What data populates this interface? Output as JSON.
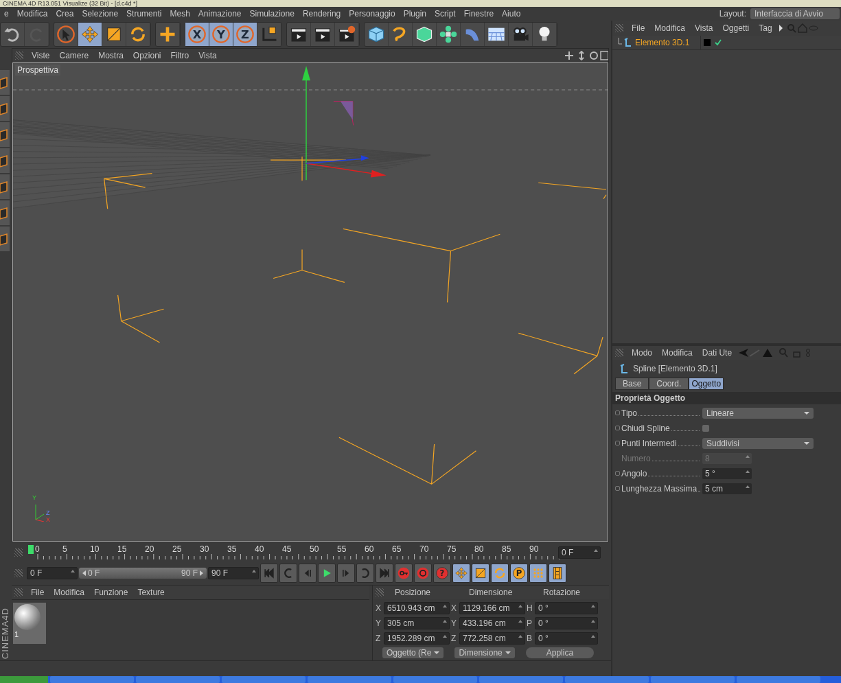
{
  "title_bar": {
    "title": "CINEMA 4D R13.051 Visualize (32 Bit) - [d.c4d *]"
  },
  "menu_bar": {
    "items": [
      "e",
      "Modifica",
      "Crea",
      "Selezione",
      "Strumenti",
      "Mesh",
      "Animazione",
      "Simulazione",
      "Rendering",
      "Personaggio",
      "Plugin",
      "Script",
      "Finestre",
      "Aiuto"
    ],
    "layout_label": "Layout:",
    "layout_value": "Interfaccia di Avvio"
  },
  "toolbar": {
    "groups": [
      [
        {
          "kind": "undo",
          "selected": false,
          "disabled": false
        },
        {
          "kind": "redo",
          "selected": false,
          "disabled": true
        }
      ],
      [
        {
          "kind": "select",
          "selected": false,
          "disabled": false
        },
        {
          "kind": "move",
          "selected": true,
          "disabled": false
        },
        {
          "kind": "scale",
          "selected": false,
          "disabled": false
        },
        {
          "kind": "rotate",
          "selected": false,
          "disabled": false
        }
      ],
      [
        {
          "kind": "add",
          "selected": false,
          "disabled": false
        }
      ],
      [
        {
          "kind": "axis",
          "label": "X",
          "selected": true,
          "disabled": false
        },
        {
          "kind": "axis",
          "label": "Y",
          "selected": true,
          "disabled": false
        },
        {
          "kind": "axis",
          "label": "Z",
          "selected": true,
          "disabled": false
        },
        {
          "kind": "coords",
          "selected": false,
          "disabled": false
        }
      ],
      [
        {
          "kind": "render",
          "selected": false,
          "disabled": false
        },
        {
          "kind": "render",
          "selected": false,
          "disabled": false
        },
        {
          "kind": "render-settings",
          "selected": false,
          "disabled": false
        }
      ],
      [
        {
          "kind": "cube",
          "selected": false,
          "disabled": false
        },
        {
          "kind": "spline",
          "selected": false,
          "disabled": false
        },
        {
          "kind": "subdivision",
          "selected": false,
          "disabled": false
        },
        {
          "kind": "cloner",
          "selected": false,
          "disabled": false
        },
        {
          "kind": "deformer",
          "selected": false,
          "disabled": false
        },
        {
          "kind": "floor",
          "selected": false,
          "disabled": false
        },
        {
          "kind": "camera",
          "selected": false,
          "disabled": false
        },
        {
          "kind": "light",
          "selected": false,
          "disabled": false
        }
      ]
    ]
  },
  "viewport": {
    "menu": [
      "Viste",
      "Camere",
      "Mostra",
      "Opzioni",
      "Filtro",
      "Vista"
    ],
    "view_name": "Prospettiva",
    "axis_labels": [
      "Y",
      "Z",
      "X"
    ]
  },
  "object_manager": {
    "menu": [
      "File",
      "Modifica",
      "Vista",
      "Oggetti",
      "Tag"
    ],
    "objects": [
      {
        "name": "Elemento 3D.1",
        "selected": true,
        "enabled": true
      }
    ]
  },
  "attribute_manager": {
    "menu": [
      "Modo",
      "Modifica",
      "Dati Ute"
    ],
    "title": "Spline [Elemento 3D.1]",
    "tabs": [
      {
        "label": "Base",
        "selected": false
      },
      {
        "label": "Coord.",
        "selected": false
      },
      {
        "label": "Oggetto",
        "selected": true
      }
    ],
    "section": "Proprietà Oggetto",
    "fields": [
      {
        "kind": "dropdown",
        "label": "Tipo",
        "value": "Lineare",
        "disabled": false
      },
      {
        "kind": "checkbox",
        "label": "Chiudi Spline",
        "checked": false,
        "disabled": false
      },
      {
        "kind": "dropdown",
        "label": "Punti Intermedi",
        "value": "Suddivisi",
        "disabled": false
      },
      {
        "kind": "number",
        "label": "Numero",
        "value": "8",
        "disabled": true
      },
      {
        "kind": "number",
        "label": "Angolo",
        "value": "5 °",
        "disabled": false
      },
      {
        "kind": "number",
        "label": "Lunghezza Massima",
        "value": "5 cm",
        "disabled": false
      }
    ]
  },
  "timeline": {
    "labels": [
      "0",
      "5",
      "10",
      "15",
      "20",
      "25",
      "30",
      "35",
      "40",
      "45",
      "50",
      "55",
      "60",
      "65",
      "70",
      "75",
      "80",
      "85",
      "90"
    ],
    "current_frame": "0 F"
  },
  "transport": {
    "start": "0 F",
    "range_slider": {
      "start": "0 F",
      "end": "90 F",
      "level": 1
    },
    "end": "90 F",
    "buttons": [
      {
        "kind": "first",
        "selected": false
      },
      {
        "kind": "loop-back",
        "selected": false
      },
      {
        "kind": "prev",
        "selected": false
      },
      {
        "kind": "play",
        "selected": false
      },
      {
        "kind": "next",
        "selected": false
      },
      {
        "kind": "loop-fwd",
        "selected": false
      },
      {
        "kind": "last",
        "selected": false
      },
      {
        "kind": "record",
        "selected": false
      },
      {
        "kind": "autokey",
        "selected": false
      },
      {
        "kind": "help",
        "label": "?",
        "selected": false
      },
      {
        "kind": "move",
        "selected": true
      },
      {
        "kind": "scale",
        "selected": true
      },
      {
        "kind": "rotate",
        "selected": true
      },
      {
        "kind": "param",
        "label": "P",
        "selected": true
      },
      {
        "kind": "points",
        "selected": true
      },
      {
        "kind": "film",
        "selected": true
      }
    ]
  },
  "material_manager": {
    "menu": [
      "File",
      "Modifica",
      "Funzione",
      "Texture"
    ],
    "materials": [
      {
        "name": "1"
      }
    ]
  },
  "brand": "CINEMA4D",
  "coordinates": {
    "headers": [
      "Posizione",
      "Dimensione",
      "Rotazione"
    ],
    "rows": [
      {
        "pos_axis": "X",
        "pos": "6510.943 cm",
        "dim_axis": "X",
        "dim": "1129.166 cm",
        "rot_axis": "H",
        "rot": "0 °"
      },
      {
        "pos_axis": "Y",
        "pos": "305 cm",
        "dim_axis": "Y",
        "dim": "433.196 cm",
        "rot_axis": "P",
        "rot": "0 °"
      },
      {
        "pos_axis": "Z",
        "pos": "1952.289 cm",
        "dim_axis": "Z",
        "dim": "772.258 cm",
        "rot_axis": "B",
        "rot": "0 °"
      }
    ],
    "mode_dropdown": "Oggetto (Re",
    "size_dropdown": "Dimensione",
    "apply_button": "Applica"
  }
}
